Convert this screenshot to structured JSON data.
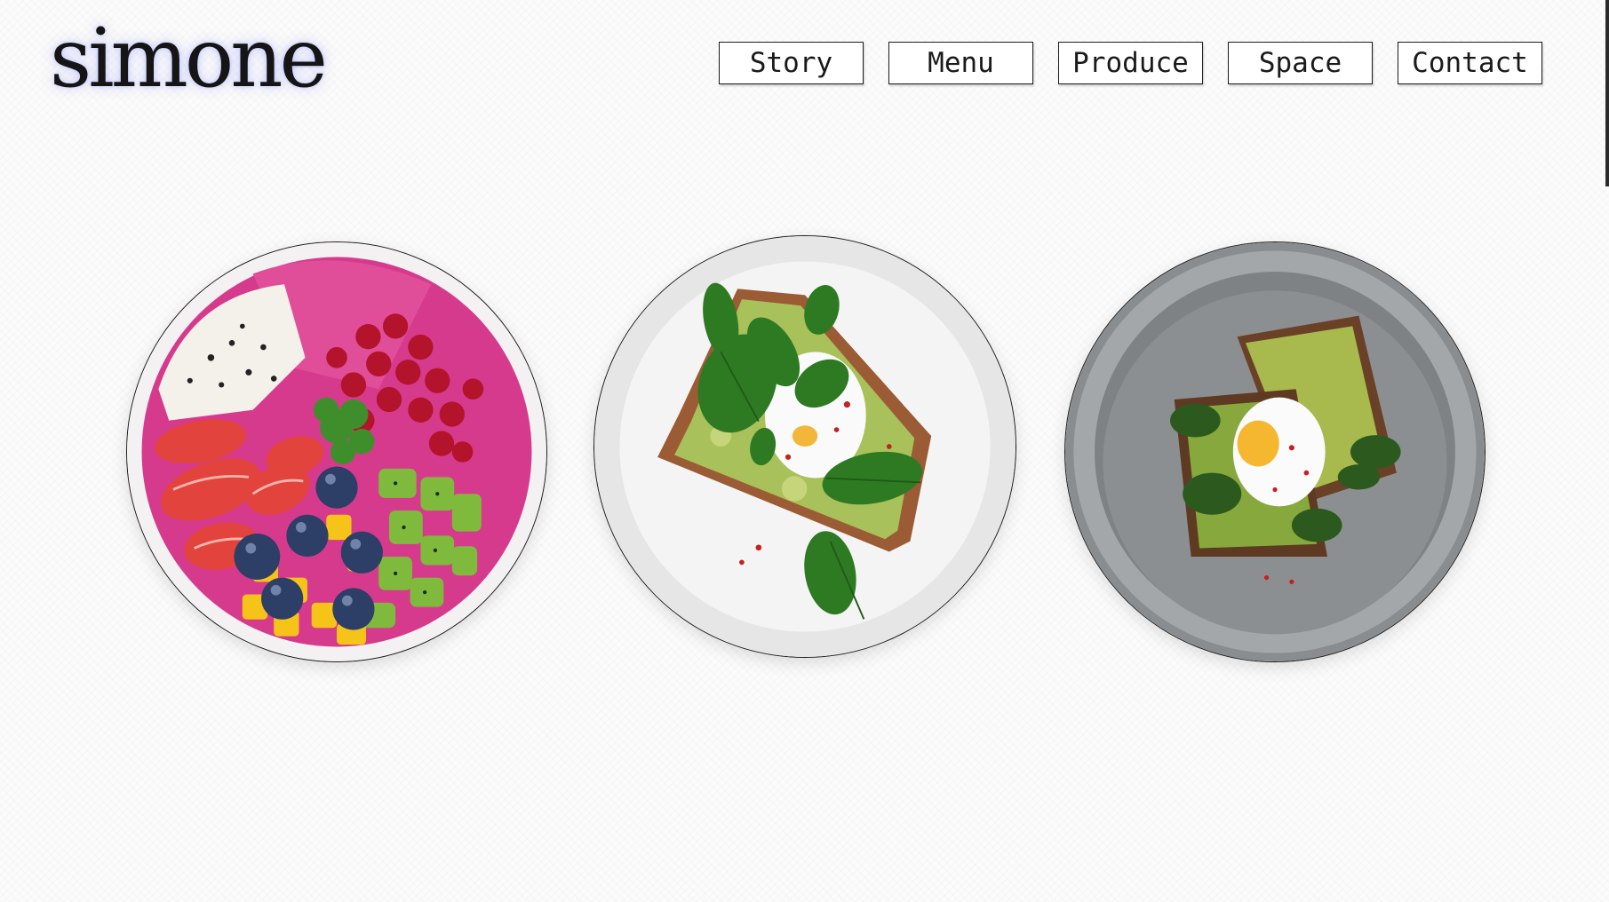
{
  "brand": {
    "logo_text": "simone"
  },
  "nav": {
    "items": [
      {
        "label": "Story"
      },
      {
        "label": "Menu"
      },
      {
        "label": "Produce"
      },
      {
        "label": "Space"
      },
      {
        "label": "Contact"
      }
    ]
  },
  "colors": {
    "background": "#fbfbfb",
    "border": "#1b1b1b",
    "logo_glow": "#828cff"
  },
  "dishes": [
    {
      "name": "fruit-smoothie-bowl"
    },
    {
      "name": "avocado-toast-white-plate"
    },
    {
      "name": "avocado-toast-grey-plate"
    }
  ]
}
